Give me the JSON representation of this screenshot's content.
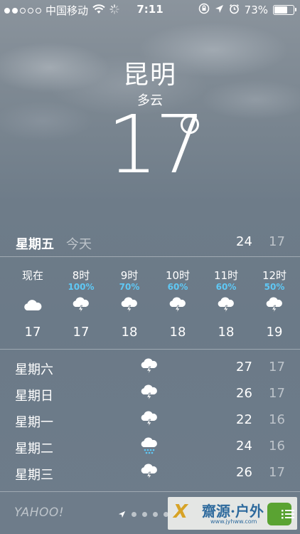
{
  "status_bar": {
    "carrier": "中国移动",
    "time": "7:11",
    "battery_percent": "73%",
    "battery_level": 0.73,
    "signal_dots": [
      true,
      true,
      false,
      false,
      false
    ],
    "icons": [
      "wifi-icon",
      "activity-spinner-icon",
      "rotation-lock-icon",
      "location-arrow-icon",
      "alarm-clock-icon",
      "battery-icon"
    ]
  },
  "weather": {
    "city": "昆明",
    "condition": "多云",
    "current_temp": "17"
  },
  "today": {
    "day": "星期五",
    "label": "今天",
    "high": "24",
    "low": "17"
  },
  "hourly": [
    {
      "time": "现在",
      "pop": "",
      "icon": "cloud-icon",
      "temp": "17"
    },
    {
      "time": "8时",
      "pop": "100%",
      "icon": "thunderstorm-icon",
      "temp": "17"
    },
    {
      "time": "9时",
      "pop": "70%",
      "icon": "thunderstorm-icon",
      "temp": "18"
    },
    {
      "time": "10时",
      "pop": "60%",
      "icon": "thunderstorm-icon",
      "temp": "18"
    },
    {
      "time": "11时",
      "pop": "60%",
      "icon": "thunderstorm-icon",
      "temp": "18"
    },
    {
      "time": "12时",
      "pop": "50%",
      "icon": "thunderstorm-icon",
      "temp": "19"
    }
  ],
  "daily": [
    {
      "day": "星期六",
      "icon": "thunderstorm-icon",
      "high": "27",
      "low": "17"
    },
    {
      "day": "星期日",
      "icon": "thunderstorm-icon",
      "high": "26",
      "low": "17"
    },
    {
      "day": "星期一",
      "icon": "thunderstorm-icon",
      "high": "22",
      "low": "16"
    },
    {
      "day": "星期二",
      "icon": "rain-icon",
      "high": "24",
      "low": "16"
    },
    {
      "day": "星期三",
      "icon": "thunderstorm-icon",
      "high": "26",
      "low": "17"
    }
  ],
  "footer": {
    "brand": "YAHOO!",
    "page_dots": 5,
    "watermark": {
      "text": "齋源·户外",
      "url": "www.jyhww.com"
    }
  },
  "colors": {
    "precipitation": "#5fc8f5",
    "dimmed_text": "rgba(255,255,255,0.55)"
  }
}
